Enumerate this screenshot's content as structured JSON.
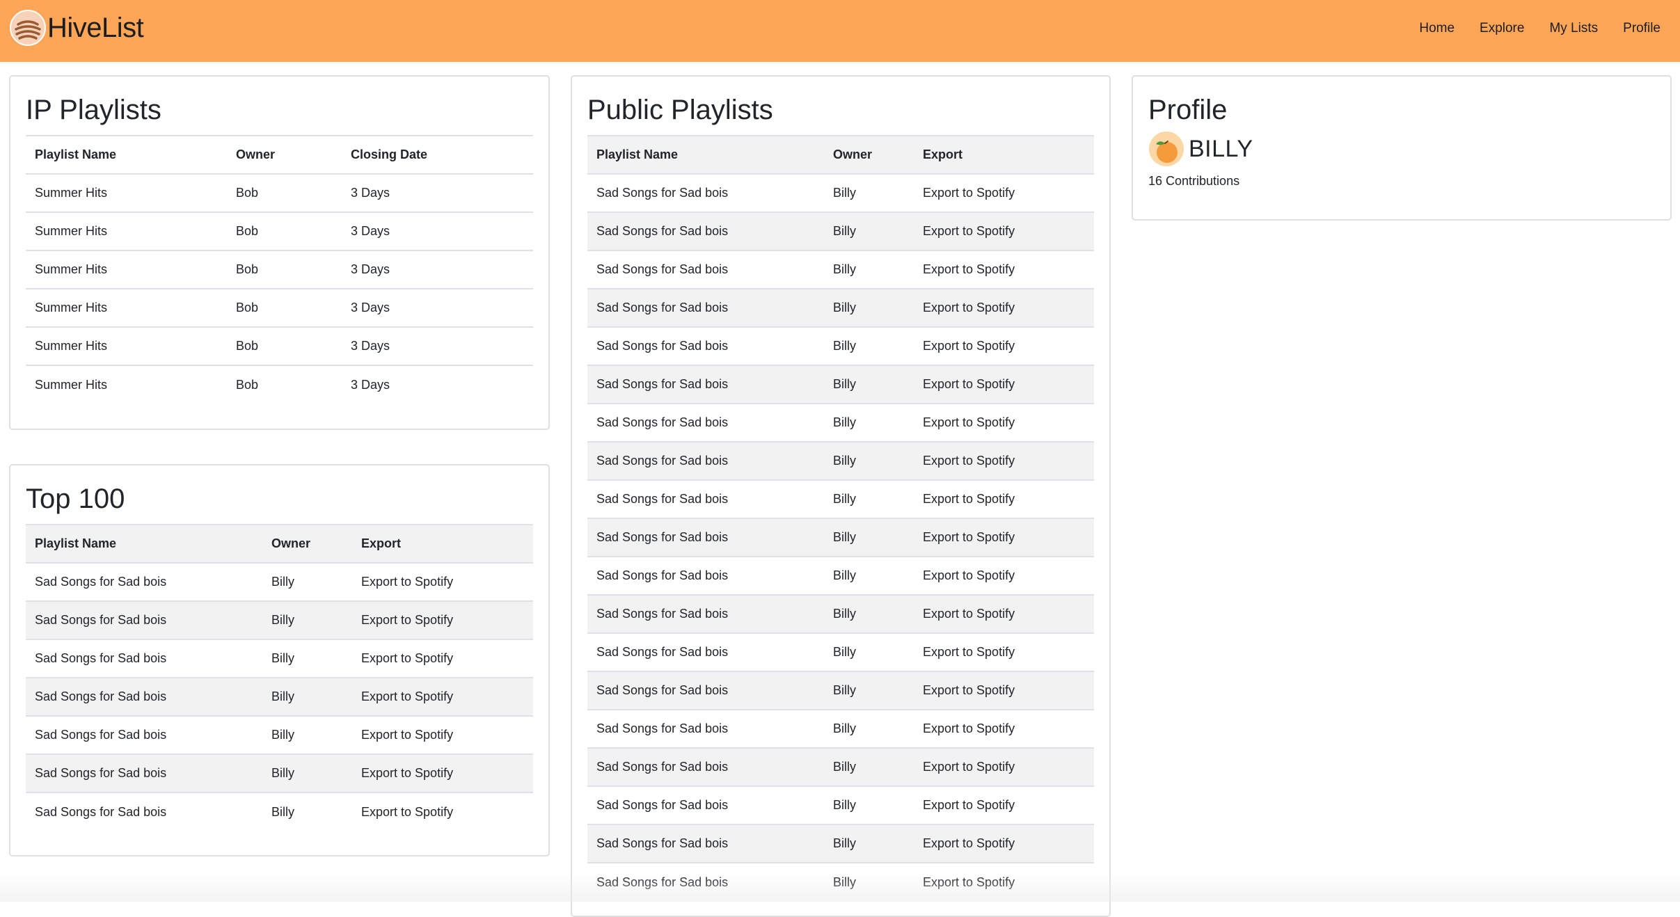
{
  "brand": {
    "name": "HiveList",
    "logo_icon": "hive-logo-icon"
  },
  "nav": {
    "items": [
      "Home",
      "Explore",
      "My Lists",
      "Profile"
    ]
  },
  "colors": {
    "navbar": "#fea657",
    "stripe": "#f2f2f2",
    "border": "#dee2e6"
  },
  "ip_playlists": {
    "title": "IP Playlists",
    "columns": [
      "Playlist Name",
      "Owner",
      "Closing Date"
    ],
    "rows": [
      [
        "Summer Hits",
        "Bob",
        "3 Days"
      ],
      [
        "Summer Hits",
        "Bob",
        "3 Days"
      ],
      [
        "Summer Hits",
        "Bob",
        "3 Days"
      ],
      [
        "Summer Hits",
        "Bob",
        "3 Days"
      ],
      [
        "Summer Hits",
        "Bob",
        "3 Days"
      ],
      [
        "Summer Hits",
        "Bob",
        "3 Days"
      ]
    ]
  },
  "top100": {
    "title": "Top 100",
    "columns": [
      "Playlist Name",
      "Owner",
      "Export"
    ],
    "rows": [
      [
        "Sad Songs for Sad bois",
        "Billy",
        "Export to Spotify"
      ],
      [
        "Sad Songs for Sad bois",
        "Billy",
        "Export to Spotify"
      ],
      [
        "Sad Songs for Sad bois",
        "Billy",
        "Export to Spotify"
      ],
      [
        "Sad Songs for Sad bois",
        "Billy",
        "Export to Spotify"
      ],
      [
        "Sad Songs for Sad bois",
        "Billy",
        "Export to Spotify"
      ],
      [
        "Sad Songs for Sad bois",
        "Billy",
        "Export to Spotify"
      ],
      [
        "Sad Songs for Sad bois",
        "Billy",
        "Export to Spotify"
      ]
    ]
  },
  "public_playlists": {
    "title": "Public Playlists",
    "columns": [
      "Playlist Name",
      "Owner",
      "Export"
    ],
    "rows": [
      [
        "Sad Songs for Sad bois",
        "Billy",
        "Export to Spotify"
      ],
      [
        "Sad Songs for Sad bois",
        "Billy",
        "Export to Spotify"
      ],
      [
        "Sad Songs for Sad bois",
        "Billy",
        "Export to Spotify"
      ],
      [
        "Sad Songs for Sad bois",
        "Billy",
        "Export to Spotify"
      ],
      [
        "Sad Songs for Sad bois",
        "Billy",
        "Export to Spotify"
      ],
      [
        "Sad Songs for Sad bois",
        "Billy",
        "Export to Spotify"
      ],
      [
        "Sad Songs for Sad bois",
        "Billy",
        "Export to Spotify"
      ],
      [
        "Sad Songs for Sad bois",
        "Billy",
        "Export to Spotify"
      ],
      [
        "Sad Songs for Sad bois",
        "Billy",
        "Export to Spotify"
      ],
      [
        "Sad Songs for Sad bois",
        "Billy",
        "Export to Spotify"
      ],
      [
        "Sad Songs for Sad bois",
        "Billy",
        "Export to Spotify"
      ],
      [
        "Sad Songs for Sad bois",
        "Billy",
        "Export to Spotify"
      ],
      [
        "Sad Songs for Sad bois",
        "Billy",
        "Export to Spotify"
      ],
      [
        "Sad Songs for Sad bois",
        "Billy",
        "Export to Spotify"
      ],
      [
        "Sad Songs for Sad bois",
        "Billy",
        "Export to Spotify"
      ],
      [
        "Sad Songs for Sad bois",
        "Billy",
        "Export to Spotify"
      ],
      [
        "Sad Songs for Sad bois",
        "Billy",
        "Export to Spotify"
      ],
      [
        "Sad Songs for Sad bois",
        "Billy",
        "Export to Spotify"
      ],
      [
        "Sad Songs for Sad bois",
        "Billy",
        "Export to Spotify"
      ]
    ]
  },
  "profile": {
    "title": "Profile",
    "username": "BILLY",
    "avatar_icon": "orange-fruit-avatar-icon",
    "contributions": "16 Contributions"
  }
}
